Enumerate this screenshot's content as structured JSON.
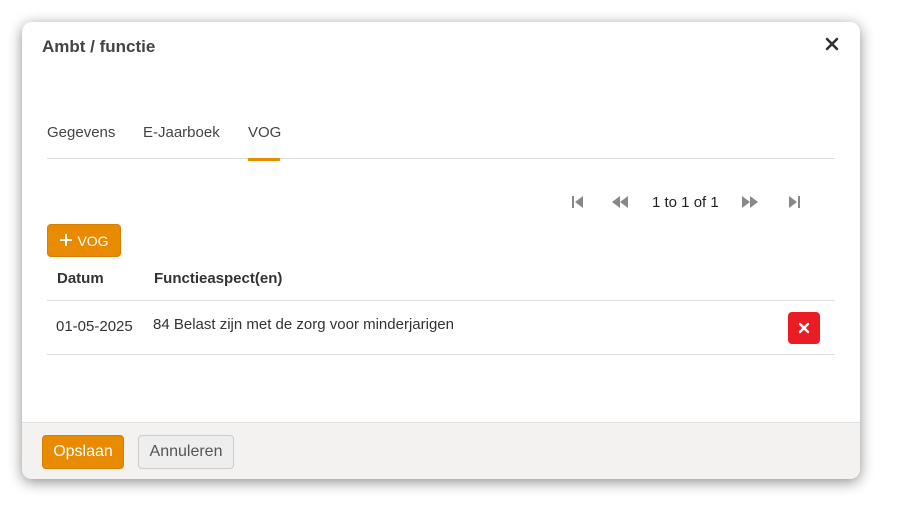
{
  "dialog": {
    "title": "Ambt / functie"
  },
  "tabs": [
    {
      "label": "Gegevens",
      "active": false
    },
    {
      "label": "E-Jaarboek",
      "active": false
    },
    {
      "label": "VOG",
      "active": true
    }
  ],
  "pager": {
    "text": "1 to 1 of 1"
  },
  "toolbar": {
    "add_label": "VOG",
    "add_icon": "plus-icon"
  },
  "table": {
    "headers": [
      "Datum",
      "Functieaspect(en)"
    ],
    "rows": [
      {
        "datum": "01-05-2025",
        "functieaspect": "84 Belast zijn met de zorg voor minderjarigen"
      }
    ]
  },
  "footer": {
    "save_label": "Opslaan",
    "cancel_label": "Annuleren"
  },
  "colors": {
    "accent": "#e88b00",
    "danger": "#ec1c24",
    "footer_bg": "#f4f2f0"
  }
}
